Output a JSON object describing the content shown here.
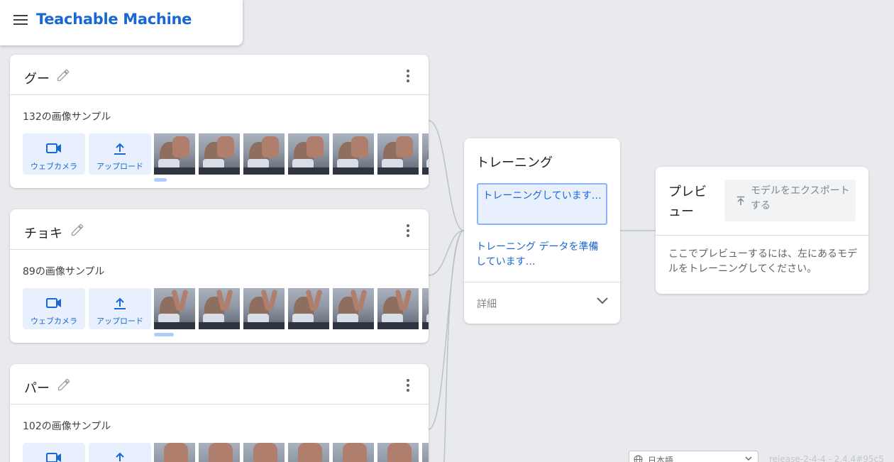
{
  "header": {
    "brand": "Teachable Machine",
    "menu_icon": "hamburger-menu-icon"
  },
  "classes": [
    {
      "name": "グー",
      "sample_count": "132の画像サンプル",
      "gesture": "fist"
    },
    {
      "name": "チョキ",
      "sample_count": "89の画像サンプル",
      "gesture": "peace"
    },
    {
      "name": "パー",
      "sample_count": "102の画像サンプル",
      "gesture": "open-palm"
    }
  ],
  "class_card": {
    "webcam_label": "ウェブカメラ",
    "upload_label": "アップロード"
  },
  "training": {
    "title": "トレーニング",
    "button_label": "トレーニングしています…",
    "status": "トレーニング データを準備しています…",
    "details_label": "詳細"
  },
  "preview": {
    "title": "プレビュー",
    "export_label": "モデルをエクスポートする",
    "message": "ここでプレビューするには、左にあるモデルをトレーニングしてください。"
  },
  "footer": {
    "language": "日本語",
    "release": "release-2-4-4 - 2.4.4#95c5"
  },
  "colors": {
    "accent": "#1967d2",
    "accent_light": "#e8f0fe",
    "background": "#e8eaed"
  }
}
